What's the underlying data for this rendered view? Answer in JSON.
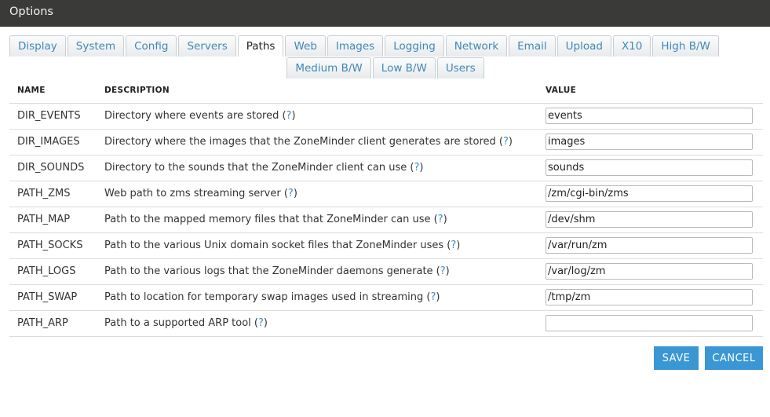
{
  "window": {
    "title": "Options"
  },
  "tabs": {
    "row1": [
      {
        "label": "Display"
      },
      {
        "label": "System"
      },
      {
        "label": "Config"
      },
      {
        "label": "Servers"
      },
      {
        "label": "Paths",
        "active": true
      },
      {
        "label": "Web"
      },
      {
        "label": "Images"
      },
      {
        "label": "Logging"
      },
      {
        "label": "Network"
      },
      {
        "label": "Email"
      },
      {
        "label": "Upload"
      },
      {
        "label": "X10"
      },
      {
        "label": "High B/W"
      }
    ],
    "row2": [
      {
        "label": "Medium B/W"
      },
      {
        "label": "Low B/W"
      },
      {
        "label": "Users"
      }
    ]
  },
  "table": {
    "headers": {
      "name": "NAME",
      "description": "DESCRIPTION",
      "value": "VALUE"
    },
    "help_mark": "?",
    "rows": [
      {
        "name": "DIR_EVENTS",
        "description": "Directory where events are stored",
        "value": "events"
      },
      {
        "name": "DIR_IMAGES",
        "description": "Directory where the images that the ZoneMinder client generates are stored",
        "value": "images"
      },
      {
        "name": "DIR_SOUNDS",
        "description": "Directory to the sounds that the ZoneMinder client can use",
        "value": "sounds"
      },
      {
        "name": "PATH_ZMS",
        "description": "Web path to zms streaming server",
        "value": "/zm/cgi-bin/zms"
      },
      {
        "name": "PATH_MAP",
        "description": "Path to the mapped memory files that that ZoneMinder can use",
        "value": "/dev/shm"
      },
      {
        "name": "PATH_SOCKS",
        "description": "Path to the various Unix domain socket files that ZoneMinder uses",
        "value": "/var/run/zm"
      },
      {
        "name": "PATH_LOGS",
        "description": "Path to the various logs that the ZoneMinder daemons generate",
        "value": "/var/log/zm"
      },
      {
        "name": "PATH_SWAP",
        "description": "Path to location for temporary swap images used in streaming",
        "value": "/tmp/zm"
      },
      {
        "name": "PATH_ARP",
        "description": "Path to a supported ARP tool",
        "value": ""
      }
    ]
  },
  "actions": {
    "save_label": "SAVE",
    "cancel_label": "CANCEL"
  },
  "colors": {
    "accent": "#3b97d3",
    "link": "#3f8ab8",
    "titlebar": "#3a3a38"
  }
}
